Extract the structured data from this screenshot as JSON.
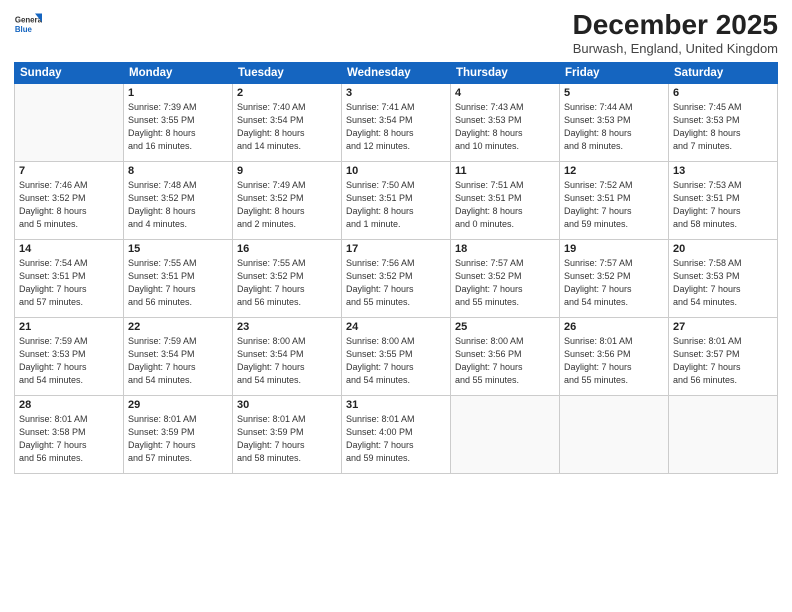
{
  "logo": {
    "general": "General",
    "blue": "Blue"
  },
  "header": {
    "month": "December 2025",
    "location": "Burwash, England, United Kingdom"
  },
  "weekdays": [
    "Sunday",
    "Monday",
    "Tuesday",
    "Wednesday",
    "Thursday",
    "Friday",
    "Saturday"
  ],
  "weeks": [
    [
      {
        "day": "",
        "info": ""
      },
      {
        "day": "1",
        "info": "Sunrise: 7:39 AM\nSunset: 3:55 PM\nDaylight: 8 hours\nand 16 minutes."
      },
      {
        "day": "2",
        "info": "Sunrise: 7:40 AM\nSunset: 3:54 PM\nDaylight: 8 hours\nand 14 minutes."
      },
      {
        "day": "3",
        "info": "Sunrise: 7:41 AM\nSunset: 3:54 PM\nDaylight: 8 hours\nand 12 minutes."
      },
      {
        "day": "4",
        "info": "Sunrise: 7:43 AM\nSunset: 3:53 PM\nDaylight: 8 hours\nand 10 minutes."
      },
      {
        "day": "5",
        "info": "Sunrise: 7:44 AM\nSunset: 3:53 PM\nDaylight: 8 hours\nand 8 minutes."
      },
      {
        "day": "6",
        "info": "Sunrise: 7:45 AM\nSunset: 3:53 PM\nDaylight: 8 hours\nand 7 minutes."
      }
    ],
    [
      {
        "day": "7",
        "info": "Sunrise: 7:46 AM\nSunset: 3:52 PM\nDaylight: 8 hours\nand 5 minutes."
      },
      {
        "day": "8",
        "info": "Sunrise: 7:48 AM\nSunset: 3:52 PM\nDaylight: 8 hours\nand 4 minutes."
      },
      {
        "day": "9",
        "info": "Sunrise: 7:49 AM\nSunset: 3:52 PM\nDaylight: 8 hours\nand 2 minutes."
      },
      {
        "day": "10",
        "info": "Sunrise: 7:50 AM\nSunset: 3:51 PM\nDaylight: 8 hours\nand 1 minute."
      },
      {
        "day": "11",
        "info": "Sunrise: 7:51 AM\nSunset: 3:51 PM\nDaylight: 8 hours\nand 0 minutes."
      },
      {
        "day": "12",
        "info": "Sunrise: 7:52 AM\nSunset: 3:51 PM\nDaylight: 7 hours\nand 59 minutes."
      },
      {
        "day": "13",
        "info": "Sunrise: 7:53 AM\nSunset: 3:51 PM\nDaylight: 7 hours\nand 58 minutes."
      }
    ],
    [
      {
        "day": "14",
        "info": "Sunrise: 7:54 AM\nSunset: 3:51 PM\nDaylight: 7 hours\nand 57 minutes."
      },
      {
        "day": "15",
        "info": "Sunrise: 7:55 AM\nSunset: 3:51 PM\nDaylight: 7 hours\nand 56 minutes."
      },
      {
        "day": "16",
        "info": "Sunrise: 7:55 AM\nSunset: 3:52 PM\nDaylight: 7 hours\nand 56 minutes."
      },
      {
        "day": "17",
        "info": "Sunrise: 7:56 AM\nSunset: 3:52 PM\nDaylight: 7 hours\nand 55 minutes."
      },
      {
        "day": "18",
        "info": "Sunrise: 7:57 AM\nSunset: 3:52 PM\nDaylight: 7 hours\nand 55 minutes."
      },
      {
        "day": "19",
        "info": "Sunrise: 7:57 AM\nSunset: 3:52 PM\nDaylight: 7 hours\nand 54 minutes."
      },
      {
        "day": "20",
        "info": "Sunrise: 7:58 AM\nSunset: 3:53 PM\nDaylight: 7 hours\nand 54 minutes."
      }
    ],
    [
      {
        "day": "21",
        "info": "Sunrise: 7:59 AM\nSunset: 3:53 PM\nDaylight: 7 hours\nand 54 minutes."
      },
      {
        "day": "22",
        "info": "Sunrise: 7:59 AM\nSunset: 3:54 PM\nDaylight: 7 hours\nand 54 minutes."
      },
      {
        "day": "23",
        "info": "Sunrise: 8:00 AM\nSunset: 3:54 PM\nDaylight: 7 hours\nand 54 minutes."
      },
      {
        "day": "24",
        "info": "Sunrise: 8:00 AM\nSunset: 3:55 PM\nDaylight: 7 hours\nand 54 minutes."
      },
      {
        "day": "25",
        "info": "Sunrise: 8:00 AM\nSunset: 3:56 PM\nDaylight: 7 hours\nand 55 minutes."
      },
      {
        "day": "26",
        "info": "Sunrise: 8:01 AM\nSunset: 3:56 PM\nDaylight: 7 hours\nand 55 minutes."
      },
      {
        "day": "27",
        "info": "Sunrise: 8:01 AM\nSunset: 3:57 PM\nDaylight: 7 hours\nand 56 minutes."
      }
    ],
    [
      {
        "day": "28",
        "info": "Sunrise: 8:01 AM\nSunset: 3:58 PM\nDaylight: 7 hours\nand 56 minutes."
      },
      {
        "day": "29",
        "info": "Sunrise: 8:01 AM\nSunset: 3:59 PM\nDaylight: 7 hours\nand 57 minutes."
      },
      {
        "day": "30",
        "info": "Sunrise: 8:01 AM\nSunset: 3:59 PM\nDaylight: 7 hours\nand 58 minutes."
      },
      {
        "day": "31",
        "info": "Sunrise: 8:01 AM\nSunset: 4:00 PM\nDaylight: 7 hours\nand 59 minutes."
      },
      {
        "day": "",
        "info": ""
      },
      {
        "day": "",
        "info": ""
      },
      {
        "day": "",
        "info": ""
      }
    ]
  ]
}
